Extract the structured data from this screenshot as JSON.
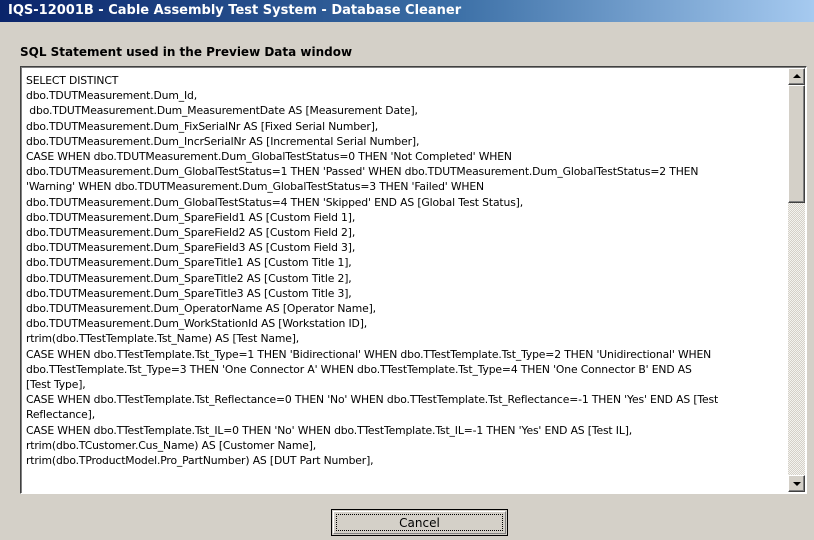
{
  "window": {
    "title": "IQS-12001B - Cable Assembly Test System - Database Cleaner"
  },
  "section": {
    "label": "SQL Statement used in the Preview Data window"
  },
  "sql": {
    "text": "SELECT DISTINCT\ndbo.TDUTMeasurement.Dum_Id,\n dbo.TDUTMeasurement.Dum_MeasurementDate AS [Measurement Date],\ndbo.TDUTMeasurement.Dum_FixSerialNr AS [Fixed Serial Number],\ndbo.TDUTMeasurement.Dum_IncrSerialNr AS [Incremental Serial Number],\nCASE WHEN dbo.TDUTMeasurement.Dum_GlobalTestStatus=0 THEN 'Not Completed' WHEN\ndbo.TDUTMeasurement.Dum_GlobalTestStatus=1 THEN 'Passed' WHEN dbo.TDUTMeasurement.Dum_GlobalTestStatus=2 THEN\n'Warning' WHEN dbo.TDUTMeasurement.Dum_GlobalTestStatus=3 THEN 'Failed' WHEN\ndbo.TDUTMeasurement.Dum_GlobalTestStatus=4 THEN 'Skipped' END AS [Global Test Status],\ndbo.TDUTMeasurement.Dum_SpareField1 AS [Custom Field 1],\ndbo.TDUTMeasurement.Dum_SpareField2 AS [Custom Field 2],\ndbo.TDUTMeasurement.Dum_SpareField3 AS [Custom Field 3],\ndbo.TDUTMeasurement.Dum_SpareTitle1 AS [Custom Title 1],\ndbo.TDUTMeasurement.Dum_SpareTitle2 AS [Custom Title 2],\ndbo.TDUTMeasurement.Dum_SpareTitle3 AS [Custom Title 3],\ndbo.TDUTMeasurement.Dum_OperatorName AS [Operator Name],\ndbo.TDUTMeasurement.Dum_WorkStationId AS [Workstation ID],\nrtrim(dbo.TTestTemplate.Tst_Name) AS [Test Name],\nCASE WHEN dbo.TTestTemplate.Tst_Type=1 THEN 'Bidirectional' WHEN dbo.TTestTemplate.Tst_Type=2 THEN 'Unidirectional' WHEN\ndbo.TTestTemplate.Tst_Type=3 THEN 'One Connector A' WHEN dbo.TTestTemplate.Tst_Type=4 THEN 'One Connector B' END AS\n[Test Type],\nCASE WHEN dbo.TTestTemplate.Tst_Reflectance=0 THEN 'No' WHEN dbo.TTestTemplate.Tst_Reflectance=-1 THEN 'Yes' END AS [Test\nReflectance],\nCASE WHEN dbo.TTestTemplate.Tst_IL=0 THEN 'No' WHEN dbo.TTestTemplate.Tst_IL=-1 THEN 'Yes' END AS [Test IL],\nrtrim(dbo.TCustomer.Cus_Name) AS [Customer Name],\nrtrim(dbo.TProductModel.Pro_PartNumber) AS [DUT Part Number],"
  },
  "buttons": {
    "cancel_label": "Cancel"
  },
  "icons": {
    "scroll_up": "arrow-up-icon",
    "scroll_down": "arrow-down-icon"
  },
  "colors": {
    "titlebar_start": "#0a246a",
    "titlebar_end": "#a6caf0",
    "face": "#d4d0c8"
  }
}
